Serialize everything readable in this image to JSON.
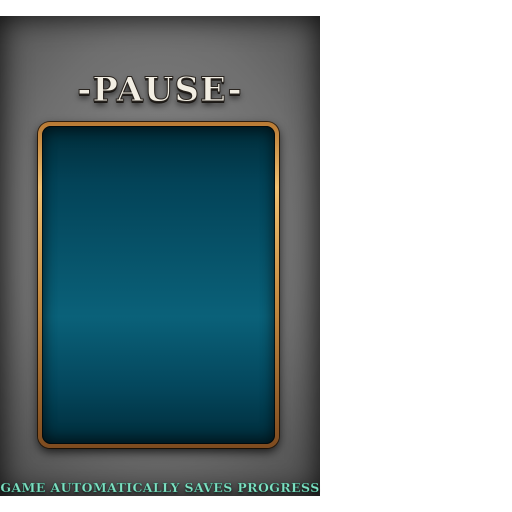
{
  "pause_screen": {
    "title": "-PAUSE-",
    "caption": "GAME AUTOMATICALLY SAVES PROGRESS"
  },
  "colors": {
    "frame_dark": "#141414",
    "frame_light": "#8a8a8a",
    "panel_teal": "#0a6179",
    "panel_border_gold": "#f0c070",
    "title_text": "#f2eee3",
    "caption_text": "#7fe0c2"
  }
}
